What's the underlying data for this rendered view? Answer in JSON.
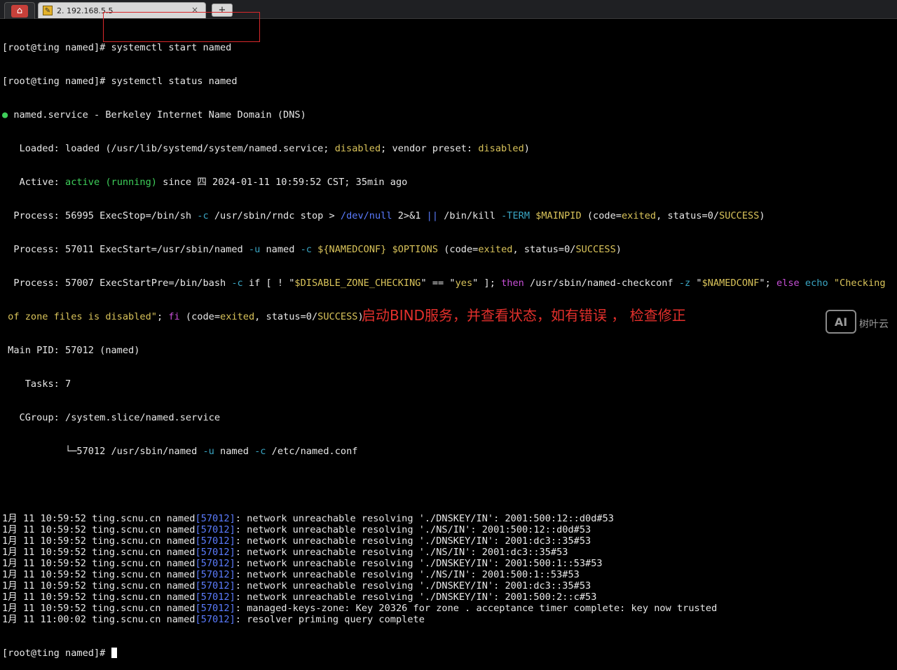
{
  "tabs": {
    "home_icon": "home-icon",
    "session_title": "2. 192.168.5.5",
    "close": "×",
    "new_tab": "+"
  },
  "terminal": {
    "line1": {
      "prompt": "[root@ting named]# ",
      "cmd": "systemctl start named"
    },
    "line2": {
      "prompt": "[root@ting named]# ",
      "cmd": "systemctl status named"
    },
    "line3": {
      "dot": "●",
      "text": " named.service - Berkeley Internet Name Domain (DNS)"
    },
    "line4": {
      "a": "   Loaded: loaded (/usr/lib/systemd/system/named.service; ",
      "b": "disabled",
      "c": "; vendor preset: ",
      "d": "disabled",
      "e": ")"
    },
    "line5": {
      "a": "   Active: ",
      "b": "active (running)",
      "c": " since 四 2024-01-11 10:59:52 CST; 35min ago"
    },
    "line6": {
      "a": "  Process: 56995 ExecStop=/bin/sh ",
      "b": "-c",
      "c": " /usr/sbin/rndc stop > ",
      "d": "/dev/null",
      "e": " 2>&1 ",
      "f": "||",
      "g": " /bin/kill ",
      "h": "-TERM",
      "i": " ",
      "j": "$MAINPID",
      "k": " (code=",
      "l": "exited",
      "m": ", status=0/",
      "n": "SUCCESS",
      "o": ")"
    },
    "line7": {
      "a": "  Process: 57011 ExecStart=/usr/sbin/named ",
      "b": "-u",
      "c": " named ",
      "d": "-c",
      "e": " ",
      "f": "${NAMEDCONF}",
      "g": " ",
      "h": "$OPTIONS",
      "i": " (code=",
      "j": "exited",
      "k": ", status=0/",
      "l": "SUCCESS",
      "m": ")"
    },
    "line8": {
      "a": "  Process: 57007 ExecStartPre=/bin/bash ",
      "b": "-c",
      "c": " if [ ! \"",
      "d": "$DISABLE_ZONE_CHECKING",
      "e": "\" == \"",
      "f": "yes",
      "g": "\" ]; ",
      "h": "then",
      "i": " /usr/sbin/named-checkconf ",
      "j": "-z",
      "k": " \"",
      "l": "$NAMEDCONF",
      "m": "\"; ",
      "n": "else",
      "o": " ",
      "p": "echo",
      "q": " \"Checking"
    },
    "line9": {
      "a": " of zone files is disabled\"",
      "b": "; ",
      "c": "fi",
      "d": " (code=",
      "e": "exited",
      "f": ", status=0/",
      "g": "SUCCESS",
      "h": ")"
    },
    "line10": " Main PID: 57012 (named)",
    "line11": "    Tasks: 7",
    "line12": "   CGroup: /system.slice/named.service",
    "line13": {
      "a": "           └─57012 /usr/sbin/named ",
      "b": "-u",
      "c": " named ",
      "d": "-c",
      "e": " /etc/named.conf"
    },
    "logs": [
      {
        "pre": "1月 11 10:59:52 ting.scnu.cn named",
        "pid": "[57012]",
        "msg": ": network unreachable resolving './DNSKEY/IN': 2001:500:12::d0d#53"
      },
      {
        "pre": "1月 11 10:59:52 ting.scnu.cn named",
        "pid": "[57012]",
        "msg": ": network unreachable resolving './NS/IN': 2001:500:12::d0d#53"
      },
      {
        "pre": "1月 11 10:59:52 ting.scnu.cn named",
        "pid": "[57012]",
        "msg": ": network unreachable resolving './DNSKEY/IN': 2001:dc3::35#53"
      },
      {
        "pre": "1月 11 10:59:52 ting.scnu.cn named",
        "pid": "[57012]",
        "msg": ": network unreachable resolving './NS/IN': 2001:dc3::35#53"
      },
      {
        "pre": "1月 11 10:59:52 ting.scnu.cn named",
        "pid": "[57012]",
        "msg": ": network unreachable resolving './DNSKEY/IN': 2001:500:1::53#53"
      },
      {
        "pre": "1月 11 10:59:52 ting.scnu.cn named",
        "pid": "[57012]",
        "msg": ": network unreachable resolving './NS/IN': 2001:500:1::53#53"
      },
      {
        "pre": "1月 11 10:59:52 ting.scnu.cn named",
        "pid": "[57012]",
        "msg": ": network unreachable resolving './DNSKEY/IN': 2001:dc3::35#53"
      },
      {
        "pre": "1月 11 10:59:52 ting.scnu.cn named",
        "pid": "[57012]",
        "msg": ": network unreachable resolving './DNSKEY/IN': 2001:500:2::c#53"
      },
      {
        "pre": "1月 11 10:59:52 ting.scnu.cn named",
        "pid": "[57012]",
        "msg": ": managed-keys-zone: Key 20326 for zone . acceptance timer complete: key now trusted"
      },
      {
        "pre": "1月 11 11:00:02 ting.scnu.cn named",
        "pid": "[57012]",
        "msg": ": resolver priming query complete"
      }
    ],
    "final_prompt": "[root@ting named]# "
  },
  "annotation": "启动BIND服务，并查看状态，如有错误 ， 检查修正",
  "watermark": {
    "logo": "AI",
    "text": "树叶云"
  },
  "colors": {
    "green": "#3ecf5a",
    "yellow": "#d9c35a",
    "blue": "#5b7cff",
    "magenta": "#c64fd6",
    "red": "#e3302c"
  }
}
